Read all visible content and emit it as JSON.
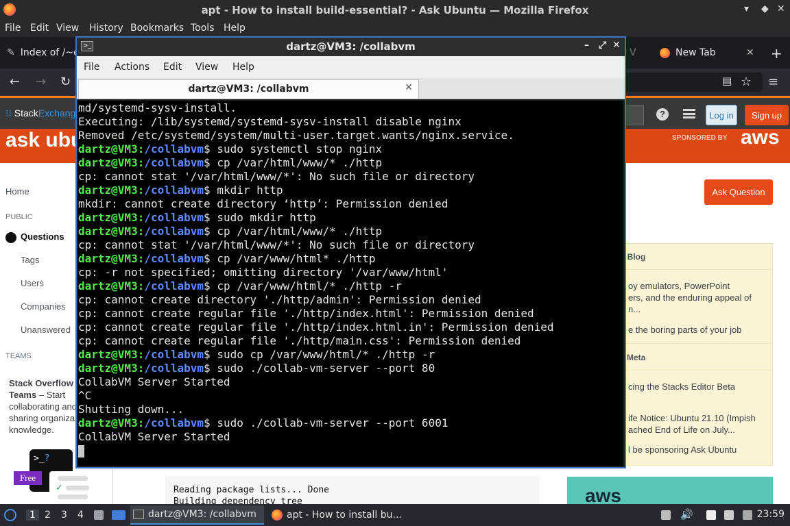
{
  "firefox": {
    "window_title": "apt - How to install build-essential? - Ask Ubuntu — Mozilla Firefox",
    "menu": [
      "File",
      "Edit",
      "View",
      "History",
      "Bookmarks",
      "Tools",
      "Help"
    ],
    "tabs": [
      {
        "label": "Index of /~d"
      },
      {
        "label": "V"
      },
      {
        "label": "New Tab"
      }
    ]
  },
  "stack": {
    "logo_stack": "Stack",
    "logo_exchange": "Exchange",
    "login": "Log in",
    "signup": "Sign up",
    "site_logo": "ask ubun",
    "sponsored_by": "SPONSORED BY",
    "sponsor": "aws"
  },
  "left_nav": {
    "home": "Home",
    "public": "PUBLIC",
    "questions": "Questions",
    "tags": "Tags",
    "users": "Users",
    "companies": "Companies",
    "unanswered": "Unanswered",
    "teams": "TEAMS",
    "teams_title_1": "Stack Overflow",
    "teams_title_2": "Teams",
    "teams_text_1": " – Start",
    "teams_text_2": "collaborating and",
    "teams_text_3": "sharing organiza",
    "teams_text_4": "knowledge."
  },
  "main": {
    "ask_question": "Ask Question",
    "code_lines": [
      "Reading package lists... Done",
      "Building dependency tree"
    ]
  },
  "sidebar": {
    "blog_header": "w Blog",
    "blog_item_1_l1": "oy emulators, PowerPoint",
    "blog_item_1_l2": "ers, and the enduring appeal of",
    "blog_item_1_l3": "n...",
    "blog_item_2": "e the boring parts of your job",
    "meta_header": "Meta",
    "meta_item_1": "cing the Stacks Editor Beta",
    "meta_item_2_l1": "ife Notice: Ubuntu 21.10 (Impish",
    "meta_item_2_l2": "ached End of Life on July...",
    "meta_item_3": "l be sponsoring Ask Ubuntu",
    "ad": "aws"
  },
  "widgets": {
    "term_prompt": ">_",
    "term_q": "?",
    "free": "Free"
  },
  "terminal": {
    "title": "dartz@VM3: /collabvm",
    "menu": [
      "File",
      "Actions",
      "Edit",
      "View",
      "Help"
    ],
    "tab_label": "dartz@VM3: /collabvm",
    "user": "dartz@VM3",
    "path": "/collabvm",
    "lines": [
      {
        "type": "out",
        "text": "md/systemd-sysv-install."
      },
      {
        "type": "out",
        "text": "Executing: /lib/systemd/systemd-sysv-install disable nginx"
      },
      {
        "type": "out",
        "text": "Removed /etc/systemd/system/multi-user.target.wants/nginx.service."
      },
      {
        "type": "cmd",
        "text": "sudo systemctl stop nginx"
      },
      {
        "type": "cmd",
        "text": "cp /var/html/www/* ./http"
      },
      {
        "type": "out",
        "text": "cp: cannot stat '/var/html/www/*': No such file or directory"
      },
      {
        "type": "cmd",
        "text": "mkdir http"
      },
      {
        "type": "out",
        "text": "mkdir: cannot create directory ‘http’: Permission denied"
      },
      {
        "type": "cmd",
        "text": "sudo mkdir http"
      },
      {
        "type": "cmd",
        "text": "cp /var/html/www/* ./http"
      },
      {
        "type": "out",
        "text": "cp: cannot stat '/var/html/www/*': No such file or directory"
      },
      {
        "type": "cmd",
        "text": "cp /var/www/html* ./http"
      },
      {
        "type": "out",
        "text": "cp: -r not specified; omitting directory '/var/www/html'"
      },
      {
        "type": "cmd",
        "text": "cp /var/www/html/* ./http -r"
      },
      {
        "type": "out",
        "text": "cp: cannot create directory './http/admin': Permission denied"
      },
      {
        "type": "out",
        "text": "cp: cannot create regular file './http/index.html': Permission denied"
      },
      {
        "type": "out",
        "text": "cp: cannot create regular file './http/index.html.in': Permission denied"
      },
      {
        "type": "out",
        "text": "cp: cannot create regular file './http/main.css': Permission denied"
      },
      {
        "type": "cmd",
        "text": "sudo cp /var/www/html/* ./http -r"
      },
      {
        "type": "cmd",
        "text": "sudo ./collab-vm-server --port 80"
      },
      {
        "type": "out",
        "text": "CollabVM Server Started"
      },
      {
        "type": "out",
        "text": "^C"
      },
      {
        "type": "out",
        "text": "Shutting down..."
      },
      {
        "type": "cmd",
        "text": "sudo ./collab-vm-server --port 6001"
      },
      {
        "type": "out",
        "text": "CollabVM Server Started"
      },
      {
        "type": "cursor",
        "text": ""
      }
    ]
  },
  "taskbar": {
    "workspaces": [
      "1",
      "2",
      "3",
      "4"
    ],
    "windows": [
      {
        "label": "dartz@VM3: /collabvm",
        "active": true
      },
      {
        "label": "apt - How to install bu...",
        "active": false
      }
    ],
    "clock": "23:59"
  },
  "colors": {
    "ubuntu_orange": "#dd4814",
    "prompt_user": "#55e84f",
    "prompt_path": "#5f8bff",
    "terminal_border": "#3c75c6"
  }
}
